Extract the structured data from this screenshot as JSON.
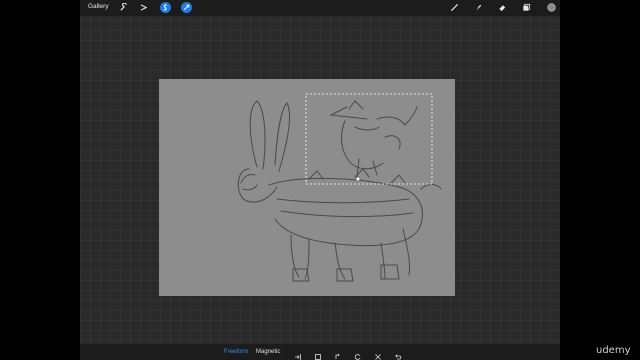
{
  "topbar": {
    "gallery_label": "Gallery",
    "left_tools": [
      "wrench-icon",
      "magic-wand-icon",
      "selection-icon",
      "transform-icon"
    ],
    "right_tools": [
      "brush-icon",
      "smudge-icon",
      "eraser-icon",
      "layers-icon",
      "color-icon"
    ]
  },
  "selection": {
    "modes": [
      "Freeform",
      "Magnetic"
    ],
    "active_mode": "Freeform",
    "actions": [
      "import-icon",
      "paste-icon",
      "invert-icon",
      "reset-icon",
      "clear-icon",
      "undo-icon"
    ]
  },
  "colors": {
    "accent": "#1e7ce8",
    "active_mode": "#3a8ef0",
    "toolbar_bg": "#1c1c1c",
    "canvas_bg": "#8d8d8d",
    "workspace_bg": "#2a2a2a",
    "current_color": "#8a8a8a"
  },
  "watermark": "udemy"
}
